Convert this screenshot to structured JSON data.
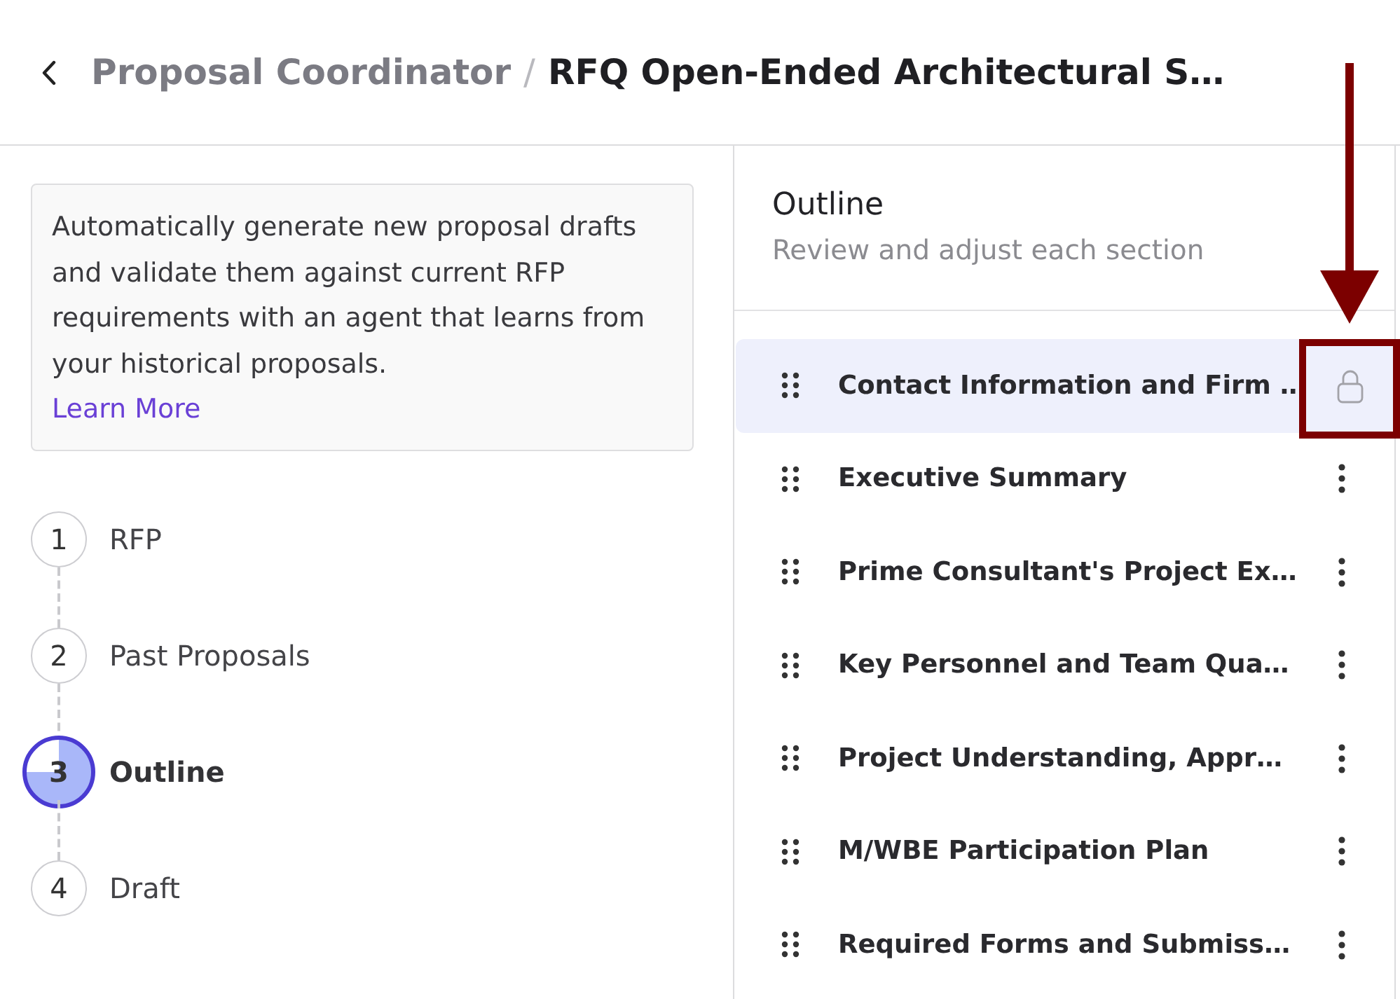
{
  "breadcrumb": {
    "separator": "/",
    "items": [
      {
        "label": "Proposal Coordinator",
        "current": false
      },
      {
        "label": "RFQ Open-Ended Architectural S…",
        "current": true
      }
    ]
  },
  "info_card": {
    "text": "Automatically generate new proposal drafts and validate them against current RFP requirements with an agent that learns from your historical proposals.",
    "link": "Learn More"
  },
  "steps": [
    {
      "number": "1",
      "label": "RFP",
      "selected": false
    },
    {
      "number": "2",
      "label": "Past Proposals",
      "selected": false
    },
    {
      "number": "3",
      "label": "Outline",
      "selected": true
    },
    {
      "number": "4",
      "label": "Draft",
      "selected": false
    }
  ],
  "outline": {
    "title": "Outline",
    "subtitle": "Review and adjust each section",
    "sections": [
      {
        "title": "Contact Information and Firm …",
        "selected": true,
        "locked": true,
        "annotated": true
      },
      {
        "title": "Executive Summary",
        "selected": false,
        "locked": false,
        "annotated": false
      },
      {
        "title": "Prime Consultant's Project Ex…",
        "selected": false,
        "locked": false,
        "annotated": false
      },
      {
        "title": "Key Personnel and Team Qua…",
        "selected": false,
        "locked": false,
        "annotated": false
      },
      {
        "title": "Project Understanding, Appr…",
        "selected": false,
        "locked": false,
        "annotated": false
      },
      {
        "title": "M/WBE Participation Plan",
        "selected": false,
        "locked": false,
        "annotated": false
      },
      {
        "title": "Required Forms and Submiss…",
        "selected": false,
        "locked": false,
        "annotated": false
      }
    ]
  }
}
